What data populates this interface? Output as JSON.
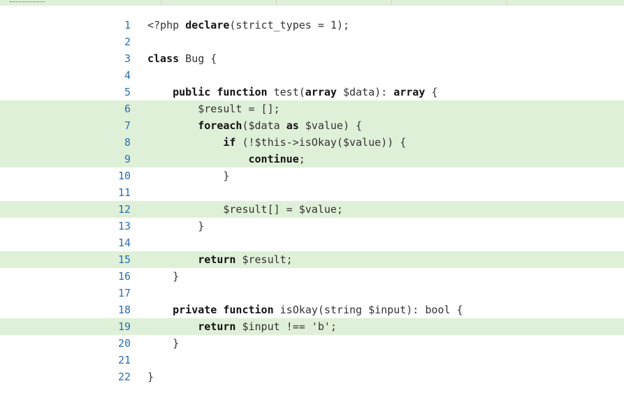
{
  "colors": {
    "covered_bg": "#dff0d8",
    "line_number": "#2a6fb0",
    "code_text": "#222222"
  },
  "lines": [
    {
      "n": "1",
      "covered": false,
      "tokens": [
        {
          "t": "<?php ",
          "k": false
        },
        {
          "t": "declare",
          "k": true
        },
        {
          "t": "(strict_types = 1);",
          "k": false
        }
      ]
    },
    {
      "n": "2",
      "covered": false,
      "tokens": []
    },
    {
      "n": "3",
      "covered": false,
      "tokens": [
        {
          "t": "class",
          "k": true
        },
        {
          "t": " Bug {",
          "k": false
        }
      ]
    },
    {
      "n": "4",
      "covered": false,
      "tokens": []
    },
    {
      "n": "5",
      "covered": false,
      "tokens": [
        {
          "t": "    ",
          "k": false
        },
        {
          "t": "public",
          "k": true
        },
        {
          "t": " ",
          "k": false
        },
        {
          "t": "function",
          "k": true
        },
        {
          "t": " test(",
          "k": false
        },
        {
          "t": "array",
          "k": true
        },
        {
          "t": " $data): ",
          "k": false
        },
        {
          "t": "array",
          "k": true
        },
        {
          "t": " {",
          "k": false
        }
      ]
    },
    {
      "n": "6",
      "covered": true,
      "tokens": [
        {
          "t": "        $result = [];",
          "k": false
        }
      ]
    },
    {
      "n": "7",
      "covered": true,
      "tokens": [
        {
          "t": "        ",
          "k": false
        },
        {
          "t": "foreach",
          "k": true
        },
        {
          "t": "($data ",
          "k": false
        },
        {
          "t": "as",
          "k": true
        },
        {
          "t": " $value) {",
          "k": false
        }
      ]
    },
    {
      "n": "8",
      "covered": true,
      "tokens": [
        {
          "t": "            ",
          "k": false
        },
        {
          "t": "if",
          "k": true
        },
        {
          "t": " (!$this->isOkay($value)) {",
          "k": false
        }
      ]
    },
    {
      "n": "9",
      "covered": true,
      "tokens": [
        {
          "t": "                ",
          "k": false
        },
        {
          "t": "continue",
          "k": true
        },
        {
          "t": ";",
          "k": false
        }
      ]
    },
    {
      "n": "10",
      "covered": false,
      "tokens": [
        {
          "t": "            }",
          "k": false
        }
      ]
    },
    {
      "n": "11",
      "covered": false,
      "tokens": []
    },
    {
      "n": "12",
      "covered": true,
      "tokens": [
        {
          "t": "            $result[] = $value;",
          "k": false
        }
      ]
    },
    {
      "n": "13",
      "covered": false,
      "tokens": [
        {
          "t": "        }",
          "k": false
        }
      ]
    },
    {
      "n": "14",
      "covered": false,
      "tokens": []
    },
    {
      "n": "15",
      "covered": true,
      "tokens": [
        {
          "t": "        ",
          "k": false
        },
        {
          "t": "return",
          "k": true
        },
        {
          "t": " $result;",
          "k": false
        }
      ]
    },
    {
      "n": "16",
      "covered": false,
      "tokens": [
        {
          "t": "    }",
          "k": false
        }
      ]
    },
    {
      "n": "17",
      "covered": false,
      "tokens": []
    },
    {
      "n": "18",
      "covered": false,
      "tokens": [
        {
          "t": "    ",
          "k": false
        },
        {
          "t": "private",
          "k": true
        },
        {
          "t": " ",
          "k": false
        },
        {
          "t": "function",
          "k": true
        },
        {
          "t": " isOkay(string $input): bool {",
          "k": false
        }
      ]
    },
    {
      "n": "19",
      "covered": true,
      "tokens": [
        {
          "t": "        ",
          "k": false
        },
        {
          "t": "return",
          "k": true
        },
        {
          "t": " $input !== 'b';",
          "k": false
        }
      ]
    },
    {
      "n": "20",
      "covered": false,
      "tokens": [
        {
          "t": "    }",
          "k": false
        }
      ]
    },
    {
      "n": "21",
      "covered": false,
      "tokens": []
    },
    {
      "n": "22",
      "covered": false,
      "tokens": [
        {
          "t": "}",
          "k": false
        }
      ]
    }
  ]
}
